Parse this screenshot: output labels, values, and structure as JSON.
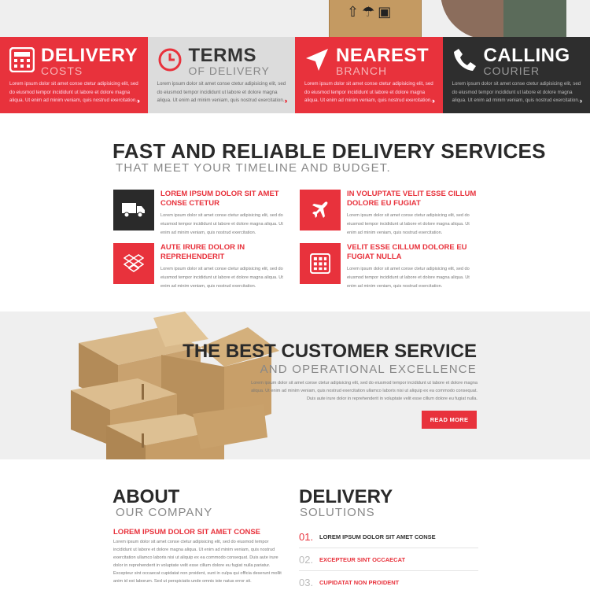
{
  "features": [
    {
      "title": "DELIVERY",
      "subtitle": "COSTS",
      "icon": "calculator-icon",
      "style": "red",
      "text": "Lorem ipsum dolor sit amet conse ctetur adipisicing elit, sed do eiusmod tempor incididunt ut labore et dolore magna aliqua. Ut enim ad minim veniam, quis nostrud exercitation."
    },
    {
      "title": "TERMS",
      "subtitle": "OF DELIVERY",
      "icon": "clock-icon",
      "style": "light",
      "text": "Lorem ipsum dolor sit amet conse ctetur adipisicing elit, sed do eiusmod tempor incididunt ut labore et dolore magna aliqua. Ut enim ad minim veniam, quis nostrud exercitation."
    },
    {
      "title": "NEAREST",
      "subtitle": "BRANCH",
      "icon": "location-arrow-icon",
      "style": "red",
      "text": "Lorem ipsum dolor sit amet conse ctetur adipisicing elit, sed do eiusmod tempor incididunt ut labore et dolore magna aliqua. Ut enim ad minim veniam, quis nostrud exercitation."
    },
    {
      "title": "CALLING",
      "subtitle": "COURIER",
      "icon": "phone-icon",
      "style": "dark",
      "text": "Lorem ipsum dolor sit amet conse ctetur adipisicing elit, sed do eiusmod tempor incididunt ut labore et dolore magna aliqua. Ut enim ad minim veniam, quis nostrud exercitation."
    }
  ],
  "services": {
    "title": "FAST AND RELIABLE DELIVERY SERVICES",
    "subtitle": "THAT MEET YOUR TIMELINE AND BUDGET.",
    "items": [
      {
        "heading": "LOREM IPSUM DOLOR SIT AMET CONSE CTETUR",
        "icon": "truck-icon",
        "text": "Lorem ipsum dolor sit amet conse ctetur adipisicing elit, sed do eiusmod tempor incididunt ut labore et dolore magna aliqua. Ut enim ad minim veniam, quis nostrud exercitation."
      },
      {
        "heading": "IN VOLUPTATE VELIT ESSE CILLUM DOLORE EU FUGIAT",
        "icon": "airplane-icon",
        "text": "Lorem ipsum dolor sit amet conse ctetur adipisicing elit, sed do eiusmod tempor incididunt ut labore et dolore magna aliqua. Ut enim ad minim veniam, quis nostrud exercitation."
      },
      {
        "heading": "AUTE IRURE DOLOR IN REPREHENDERIT",
        "icon": "dropbox-icon",
        "text": "Lorem ipsum dolor sit amet conse ctetur adipisicing elit, sed do eiusmod tempor incididunt ut labore et dolore magna aliqua. Ut enim ad minim veniam, quis nostrud exercitation."
      },
      {
        "heading": "VELIT ESSE CILLUM DOLORE EU FUGIAT NULLA",
        "icon": "calculator-icon",
        "text": "Lorem ipsum dolor sit amet conse ctetur adipisicing elit, sed do eiusmod tempor incididunt ut labore et dolore magna aliqua. Ut enim ad minim veniam, quis nostrud exercitation."
      }
    ]
  },
  "customer_service": {
    "title": "THE BEST CUSTOMER SERVICE",
    "subtitle": "AND OPERATIONAL EXCELLENCE",
    "text": "Lorem ipsum dolor sit amet conse ctetur adipisicing elit, sed do eiusmod tempor incididunt ut labore et dolore magna aliqua. Ut enim ad minim veniam, quis nostrud exercitation ullamco laboris nisi ut aliquip ex ea commodo consequat. Duis aute irure dolor in reprehenderit in voluptate velit esse cillum dolore eu fugiat nulla.",
    "button_label": "READ MORE"
  },
  "about": {
    "title": "ABOUT",
    "subtitle": "OUR COMPANY",
    "heading": "LOREM IPSUM DOLOR SIT AMET CONSE",
    "text": "Lorem ipsum dolor sit amet conse ctetur adipisicing elit, sed do eiusmod tempor incididunt ut labore et dolore magna aliqua. Ut enim ad minim veniam, quis nostrud exercitation ullamco laboris nisi ut aliquip ex ea commodo consequat. Duis aute irure dolor in reprehenderit in voluptate velit esse cillum dolore eu fugiat nulla pariatur. Excepteur sint occaecat cupidatat non proident, sunt in culpa qui officia deserunt mollit anim id est laborum. Sed ut perspiciatis unde omnis iste natus error sit."
  },
  "delivery": {
    "title": "DELIVERY",
    "subtitle": "SOLUTIONS",
    "items": [
      {
        "num": "01.",
        "label": "LOREM IPSUM DOLOR SIT AMET CONSE",
        "active": true
      },
      {
        "num": "02.",
        "label": "EXCEPTEUR SINT OCCAECAT",
        "active": false
      },
      {
        "num": "03.",
        "label": "CUPIDATAT NON PROIDENT",
        "active": false
      }
    ]
  },
  "colors": {
    "accent": "#e8323c",
    "dark": "#2e2e2e",
    "light": "#dcdcdc"
  }
}
